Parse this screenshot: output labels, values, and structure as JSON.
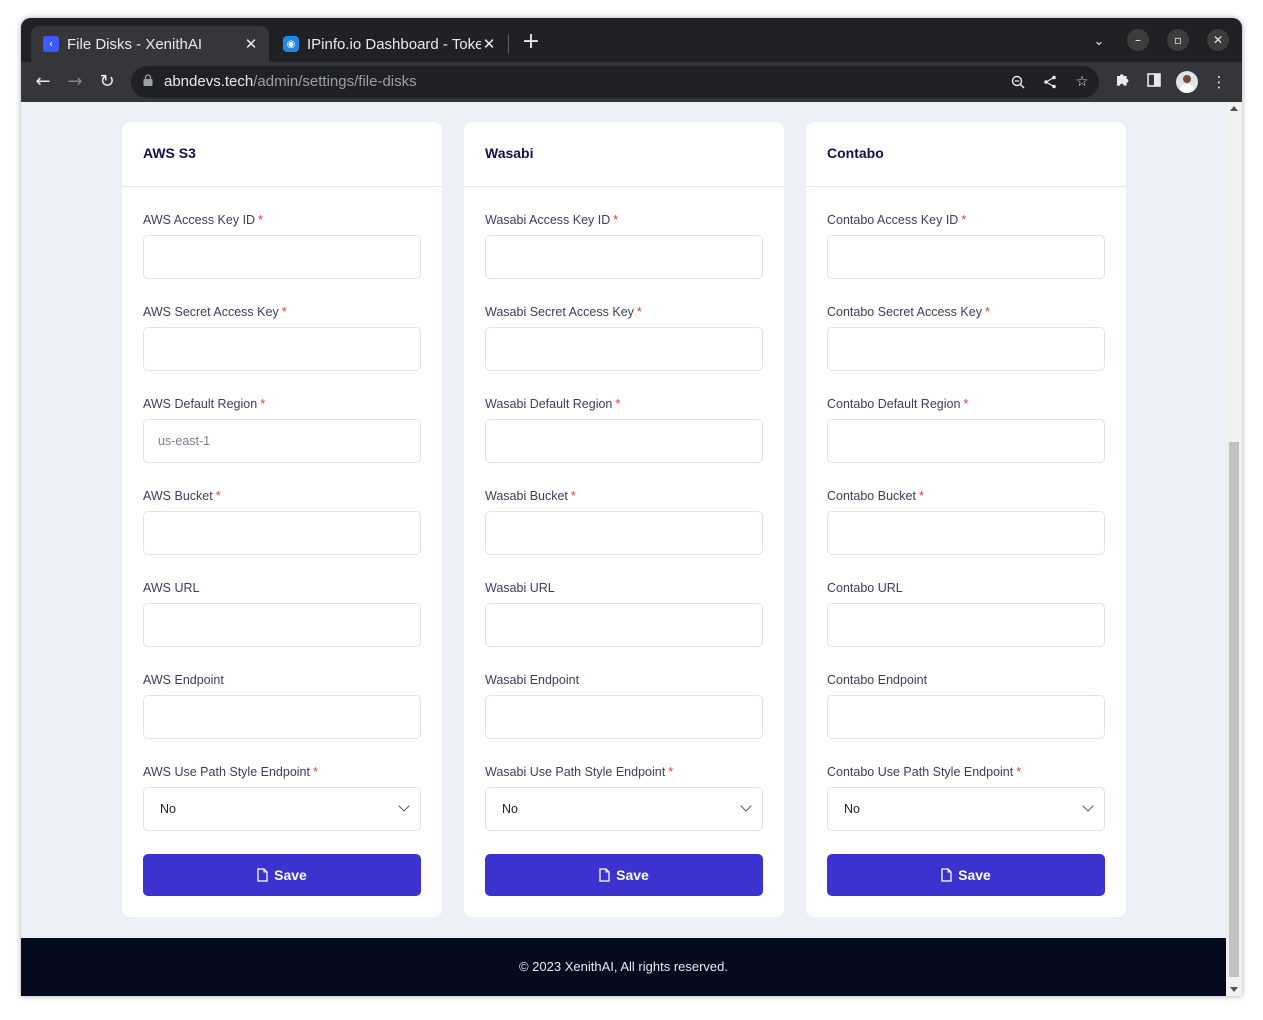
{
  "browser": {
    "tabs": [
      {
        "title": "File Disks - XenithAI",
        "active": true,
        "favicon": "xenith-logo-icon"
      },
      {
        "title": "IPinfo.io Dashboard - Toke",
        "active": false,
        "favicon": "ipinfo-logo-icon"
      }
    ],
    "url_domain": "abndevs.tech",
    "url_path": "/admin/settings/file-disks"
  },
  "cards": [
    {
      "title": "AWS S3",
      "fields": [
        {
          "label": "AWS Access Key ID",
          "required": true,
          "value": "",
          "placeholder": ""
        },
        {
          "label": "AWS Secret Access Key",
          "required": true,
          "value": "",
          "placeholder": ""
        },
        {
          "label": "AWS Default Region",
          "required": true,
          "value": "",
          "placeholder": "us-east-1"
        },
        {
          "label": "AWS Bucket",
          "required": true,
          "value": "",
          "placeholder": ""
        },
        {
          "label": "AWS URL",
          "required": false,
          "value": "",
          "placeholder": ""
        },
        {
          "label": "AWS Endpoint",
          "required": false,
          "value": "",
          "placeholder": ""
        }
      ],
      "select": {
        "label": "AWS Use Path Style Endpoint",
        "required": true,
        "value": "No"
      },
      "save_label": "Save"
    },
    {
      "title": "Wasabi",
      "fields": [
        {
          "label": "Wasabi Access Key ID",
          "required": true,
          "value": "",
          "placeholder": ""
        },
        {
          "label": "Wasabi Secret Access Key",
          "required": true,
          "value": "",
          "placeholder": ""
        },
        {
          "label": "Wasabi Default Region",
          "required": true,
          "value": "",
          "placeholder": ""
        },
        {
          "label": "Wasabi Bucket",
          "required": true,
          "value": "",
          "placeholder": ""
        },
        {
          "label": "Wasabi URL",
          "required": false,
          "value": "",
          "placeholder": ""
        },
        {
          "label": "Wasabi Endpoint",
          "required": false,
          "value": "",
          "placeholder": ""
        }
      ],
      "select": {
        "label": "Wasabi Use Path Style Endpoint",
        "required": true,
        "value": "No"
      },
      "save_label": "Save"
    },
    {
      "title": "Contabo",
      "fields": [
        {
          "label": "Contabo Access Key ID",
          "required": true,
          "value": "",
          "placeholder": ""
        },
        {
          "label": "Contabo Secret Access Key",
          "required": true,
          "value": "",
          "placeholder": ""
        },
        {
          "label": "Contabo Default Region",
          "required": true,
          "value": "",
          "placeholder": ""
        },
        {
          "label": "Contabo Bucket",
          "required": true,
          "value": "",
          "placeholder": ""
        },
        {
          "label": "Contabo URL",
          "required": false,
          "value": "",
          "placeholder": ""
        },
        {
          "label": "Contabo Endpoint",
          "required": false,
          "value": "",
          "placeholder": ""
        }
      ],
      "select": {
        "label": "Contabo Use Path Style Endpoint",
        "required": true,
        "value": "No"
      },
      "save_label": "Save"
    }
  ],
  "footer": {
    "text": "© 2023 XenithAI, All rights reserved."
  },
  "colors": {
    "primary_button": "#3c32d0",
    "required_mark": "#e53935",
    "page_bg": "#edf1f7",
    "footer_bg": "#030b1d"
  }
}
